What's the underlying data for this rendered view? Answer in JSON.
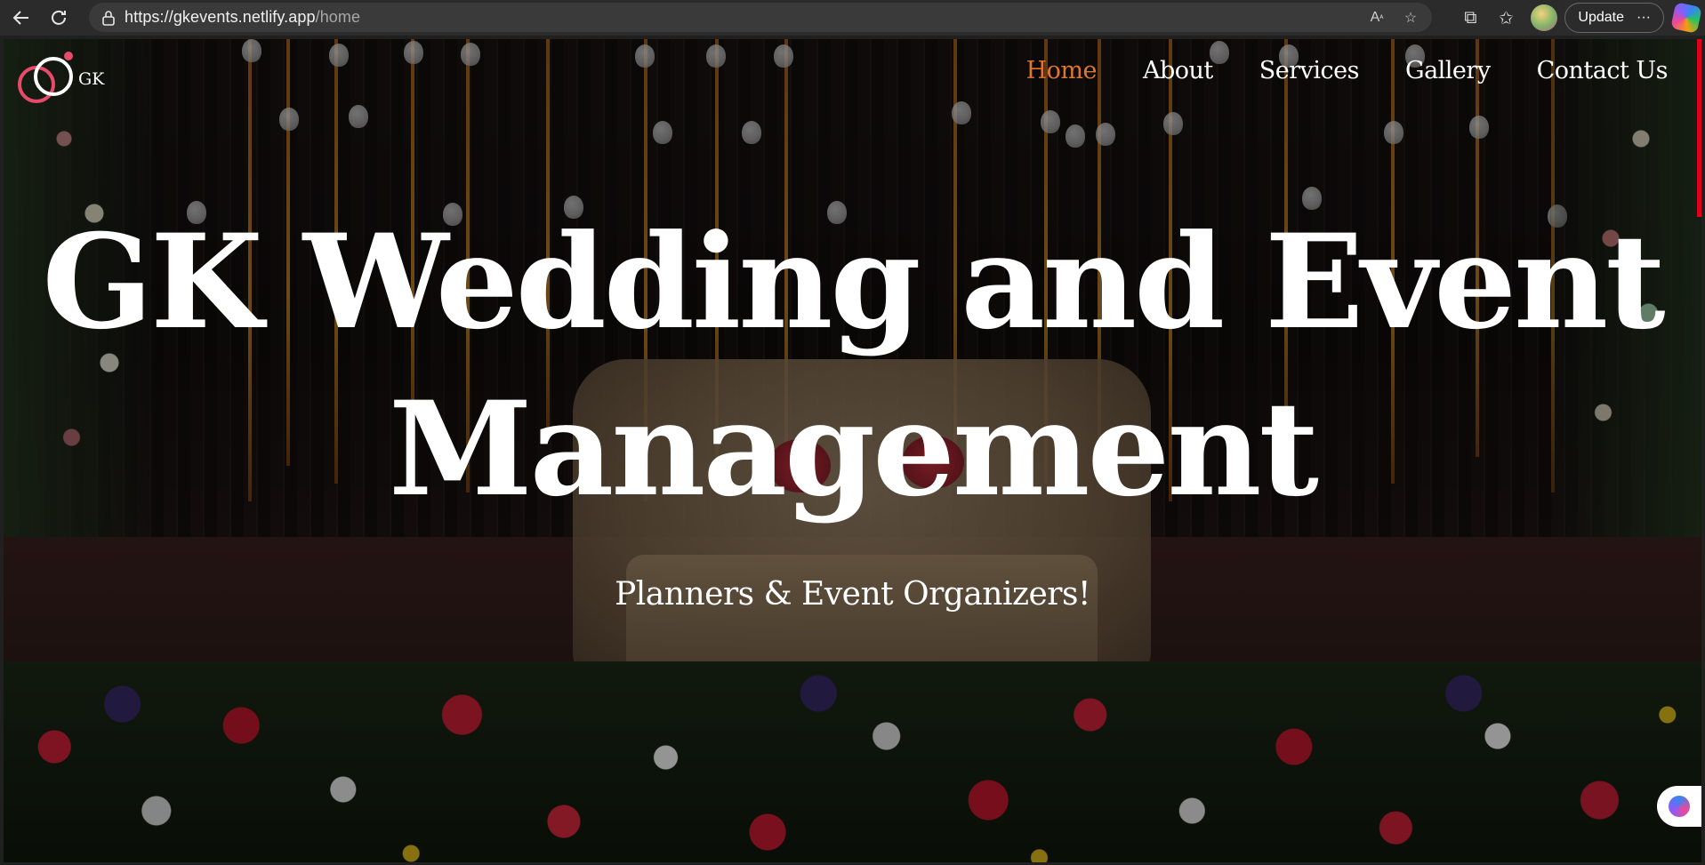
{
  "browser": {
    "url_host": "https://gkevents.netlify.app",
    "url_path": "/home",
    "update_label": "Update",
    "more_label": "···"
  },
  "site": {
    "logo_text": "GK",
    "nav": [
      {
        "label": "Home",
        "active": true
      },
      {
        "label": "About",
        "active": false
      },
      {
        "label": "Services",
        "active": false
      },
      {
        "label": "Gallery",
        "active": false
      },
      {
        "label": "Contact Us",
        "active": false
      }
    ],
    "accent_color": "#e0762b"
  },
  "hero": {
    "title_line1": "GK Wedding and Event",
    "title_line2": "Management",
    "subtitle": "Planners & Event Organizers!"
  }
}
